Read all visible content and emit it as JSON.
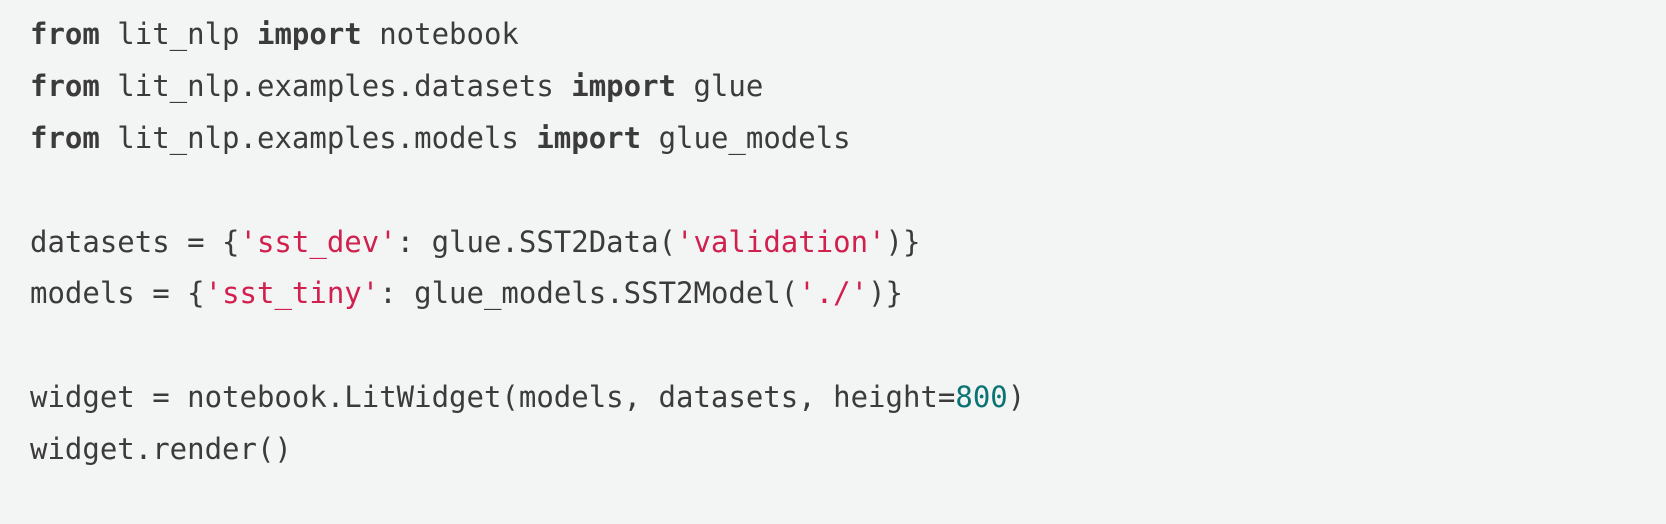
{
  "code": {
    "tokens": [
      {
        "type": "kw",
        "text": "from"
      },
      {
        "type": "txt",
        "text": " lit_nlp "
      },
      {
        "type": "kw",
        "text": "import"
      },
      {
        "type": "txt",
        "text": " notebook"
      },
      {
        "type": "nl",
        "text": "\n"
      },
      {
        "type": "kw",
        "text": "from"
      },
      {
        "type": "txt",
        "text": " lit_nlp.examples.datasets "
      },
      {
        "type": "kw",
        "text": "import"
      },
      {
        "type": "txt",
        "text": " glue"
      },
      {
        "type": "nl",
        "text": "\n"
      },
      {
        "type": "kw",
        "text": "from"
      },
      {
        "type": "txt",
        "text": " lit_nlp.examples.models "
      },
      {
        "type": "kw",
        "text": "import"
      },
      {
        "type": "txt",
        "text": " glue_models"
      },
      {
        "type": "nl",
        "text": "\n"
      },
      {
        "type": "nl",
        "text": "\n"
      },
      {
        "type": "txt",
        "text": "datasets = {"
      },
      {
        "type": "str",
        "text": "'sst_dev'"
      },
      {
        "type": "txt",
        "text": ": glue.SST2Data("
      },
      {
        "type": "str",
        "text": "'validation'"
      },
      {
        "type": "txt",
        "text": ")}"
      },
      {
        "type": "nl",
        "text": "\n"
      },
      {
        "type": "txt",
        "text": "models = {"
      },
      {
        "type": "str",
        "text": "'sst_tiny'"
      },
      {
        "type": "txt",
        "text": ": glue_models.SST2Model("
      },
      {
        "type": "str",
        "text": "'./'"
      },
      {
        "type": "txt",
        "text": ")}"
      },
      {
        "type": "nl",
        "text": "\n"
      },
      {
        "type": "nl",
        "text": "\n"
      },
      {
        "type": "txt",
        "text": "widget = notebook.LitWidget(models, datasets, height="
      },
      {
        "type": "num",
        "text": "800"
      },
      {
        "type": "txt",
        "text": ")"
      },
      {
        "type": "nl",
        "text": "\n"
      },
      {
        "type": "txt",
        "text": "widget.render()"
      }
    ]
  }
}
